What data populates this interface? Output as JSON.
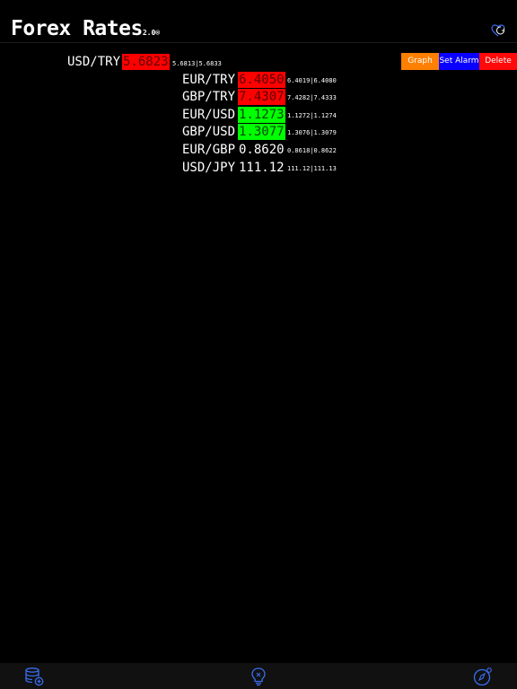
{
  "header": {
    "title": "Forex Rates",
    "version": "2.0®"
  },
  "actions": {
    "graph": "Graph",
    "set_alarm": "Set Alarm",
    "delete": "Delete"
  },
  "main_pair": {
    "pair": "USD/TRY",
    "rate": "5.6823",
    "trend": "down",
    "bid_ask": "5.6813|5.6833"
  },
  "pairs": [
    {
      "pair": "EUR/TRY",
      "rate": "6.4050",
      "trend": "down",
      "bid_ask": "6.4019|6.4080"
    },
    {
      "pair": "GBP/TRY",
      "rate": "7.4307",
      "trend": "down",
      "bid_ask": "7.4282|7.4333"
    },
    {
      "pair": "EUR/USD",
      "rate": "1.1273",
      "trend": "up",
      "bid_ask": "1.1272|1.1274"
    },
    {
      "pair": "GBP/USD",
      "rate": "1.3077",
      "trend": "up",
      "bid_ask": "1.3076|1.3079"
    },
    {
      "pair": "EUR/GBP",
      "rate": "0.8620",
      "trend": "flat",
      "bid_ask": "0.8618|0.8622"
    },
    {
      "pair": "USD/JPY",
      "rate": "111.12",
      "trend": "flat",
      "bid_ask": "111.12|111.13"
    }
  ],
  "colors": {
    "down": "#ff0000",
    "up": "#00ff00",
    "graph_button": "#ff8000",
    "alarm_button": "#0a00ff",
    "delete_button": "#ff0a0a",
    "icon_blue": "#3a6cf0"
  },
  "icons": {
    "refresh": "refresh-heart-icon",
    "tab_left": "database-add-icon",
    "tab_center": "lightbulb-icon",
    "tab_right": "compass-settings-icon"
  }
}
